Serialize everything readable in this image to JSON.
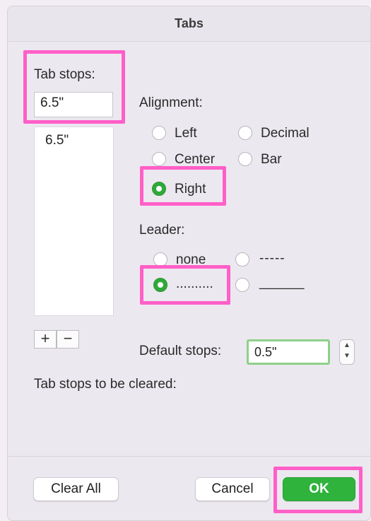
{
  "window": {
    "title": "Tabs"
  },
  "tab_stops": {
    "label": "Tab stops:",
    "input_value": "6.5\"",
    "list": [
      "6.5\""
    ]
  },
  "alignment": {
    "label": "Alignment:",
    "options": [
      "Left",
      "Decimal",
      "Center",
      "Bar",
      "Right"
    ],
    "selected": "Right"
  },
  "leader": {
    "label": "Leader:",
    "options": [
      "none",
      "-----",
      "..........",
      "______"
    ],
    "selected": ".........."
  },
  "buttons": {
    "add": "+",
    "remove": "−",
    "clear_all": "Clear All",
    "cancel": "Cancel",
    "ok": "OK"
  },
  "default_stops": {
    "label": "Default stops:",
    "value": "0.5\""
  },
  "cleared": {
    "label": "Tab stops to be cleared:"
  },
  "colors": {
    "accent": "#2fb33d",
    "highlight": "#ff5fc8"
  },
  "icons": {
    "stepper": "up-down-stepper-icon"
  }
}
